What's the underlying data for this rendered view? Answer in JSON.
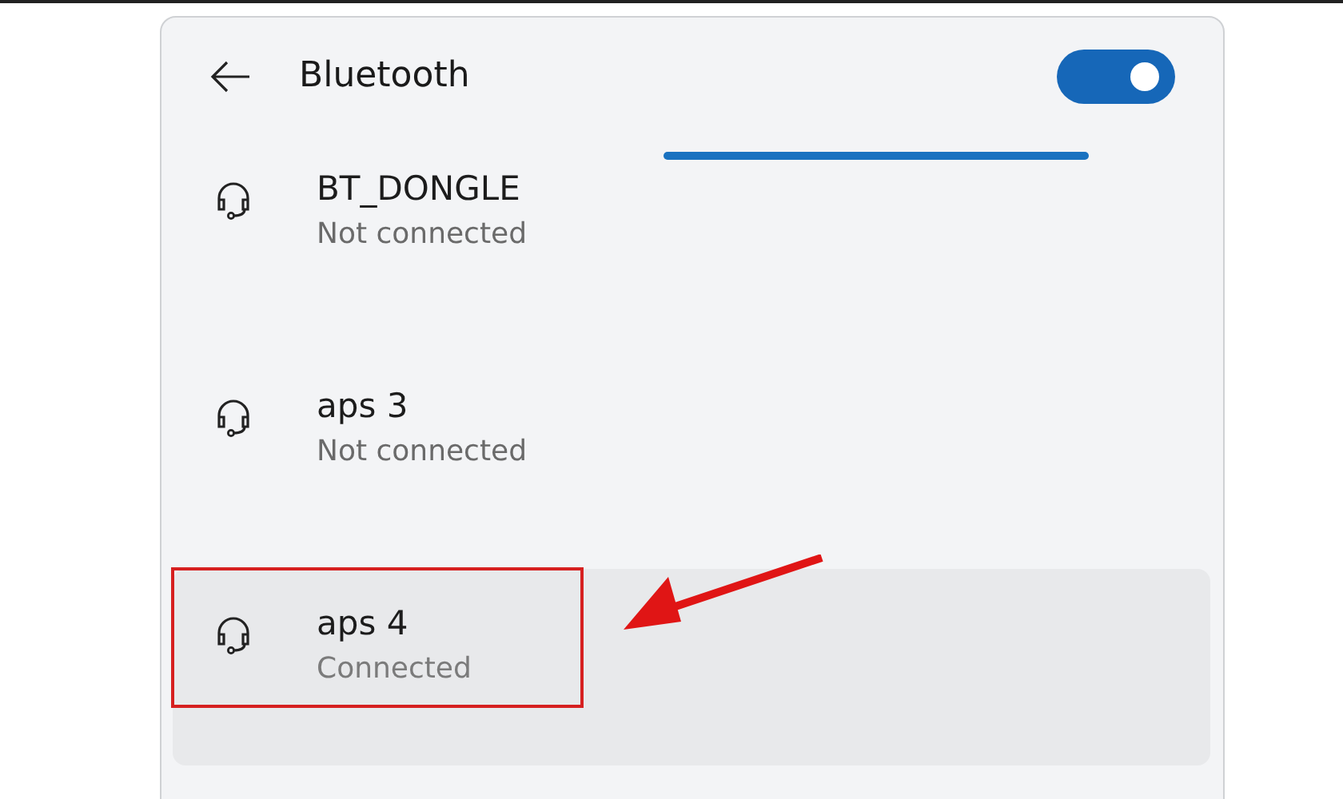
{
  "header": {
    "title": "Bluetooth",
    "toggle_on": true,
    "scanning": true
  },
  "devices": [
    {
      "name": "BT_DONGLE",
      "status": "Not connected",
      "selected": false,
      "annotated": false
    },
    {
      "name": "aps 3",
      "status": "Not connected",
      "selected": false,
      "annotated": false
    },
    {
      "name": "aps 4",
      "status": "Connected",
      "selected": true,
      "annotated": true
    }
  ]
}
